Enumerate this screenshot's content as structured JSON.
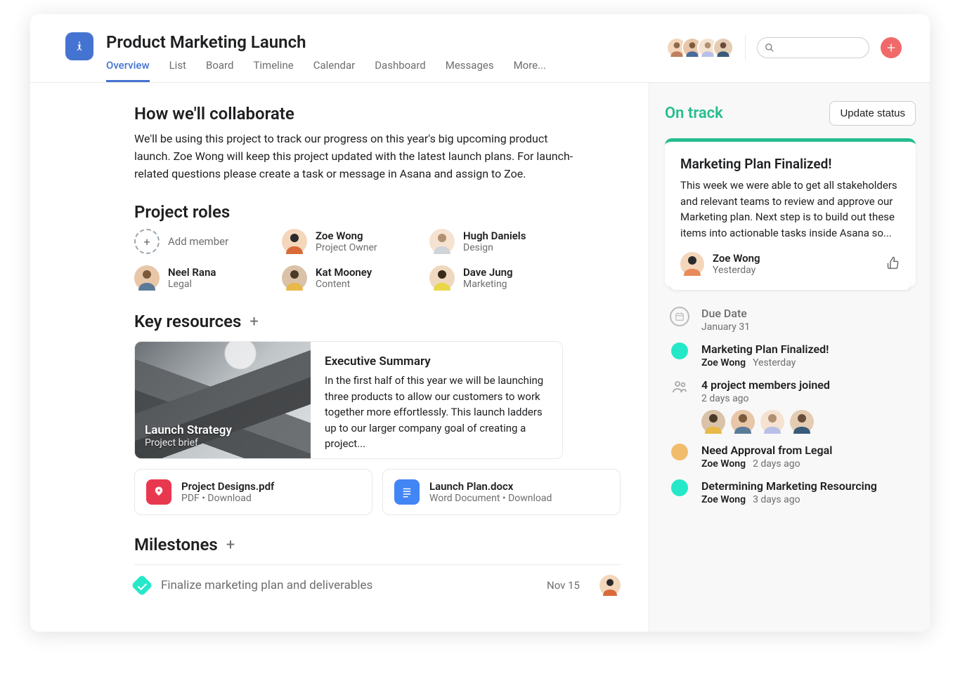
{
  "project": {
    "title": "Product Marketing Launch",
    "tabs": [
      "Overview",
      "List",
      "Board",
      "Timeline",
      "Calendar",
      "Dashboard",
      "Messages",
      "More..."
    ]
  },
  "collaborate": {
    "heading": "How we'll collaborate",
    "body": "We'll be using this project to track our progress on this year's big upcoming product launch. Zoe Wong will keep this project updated with the latest launch plans. For launch-related questions please create a task or message in Asana and assign to Zoe."
  },
  "roles": {
    "heading": "Project roles",
    "add_label": "Add member",
    "members": [
      {
        "name": "Zoe Wong",
        "role": "Project Owner"
      },
      {
        "name": "Hugh Daniels",
        "role": "Design"
      },
      {
        "name": "Neel Rana",
        "role": "Legal"
      },
      {
        "name": "Kat Mooney",
        "role": "Content"
      },
      {
        "name": "Dave Jung",
        "role": "Marketing"
      }
    ]
  },
  "resources": {
    "heading": "Key resources",
    "brief": {
      "overlay_title": "Launch Strategy",
      "overlay_sub": "Project brief",
      "title": "Executive Summary",
      "body": "In the first half of this year we will be launching three products to allow our customers to work together more effortlessly. This launch ladders up to our larger company goal of creating a project..."
    },
    "files": [
      {
        "name": "Project Designs.pdf",
        "meta": "PDF  •  Download",
        "kind": "pdf"
      },
      {
        "name": "Launch Plan.docx",
        "meta": "Word Document  •  Download",
        "kind": "doc"
      }
    ]
  },
  "milestones": {
    "heading": "Milestones",
    "items": [
      {
        "title": "Finalize marketing plan and deliverables",
        "date": "Nov 15"
      }
    ]
  },
  "status": {
    "label": "On track",
    "button": "Update status",
    "update": {
      "title": "Marketing Plan Finalized!",
      "body": "This week we were able to get all stakeholders and relevant teams to review and approve our Marketing plan. Next step is to build out these items into actionable tasks inside Asana so...",
      "author": "Zoe Wong",
      "time": "Yesterday"
    }
  },
  "timeline": {
    "due_date_label": "Due Date",
    "due_date_value": "January 31",
    "items": [
      {
        "kind": "green",
        "title": "Marketing Plan Finalized!",
        "author": "Zoe Wong",
        "time": "Yesterday"
      },
      {
        "kind": "people",
        "title": "4 project members joined",
        "time": "2 days ago"
      },
      {
        "kind": "yellow",
        "title": "Need Approval from Legal",
        "author": "Zoe Wong",
        "time": "2 days ago"
      },
      {
        "kind": "green",
        "title": "Determining Marketing Resourcing",
        "author": "Zoe Wong",
        "time": "3 days ago"
      }
    ]
  }
}
